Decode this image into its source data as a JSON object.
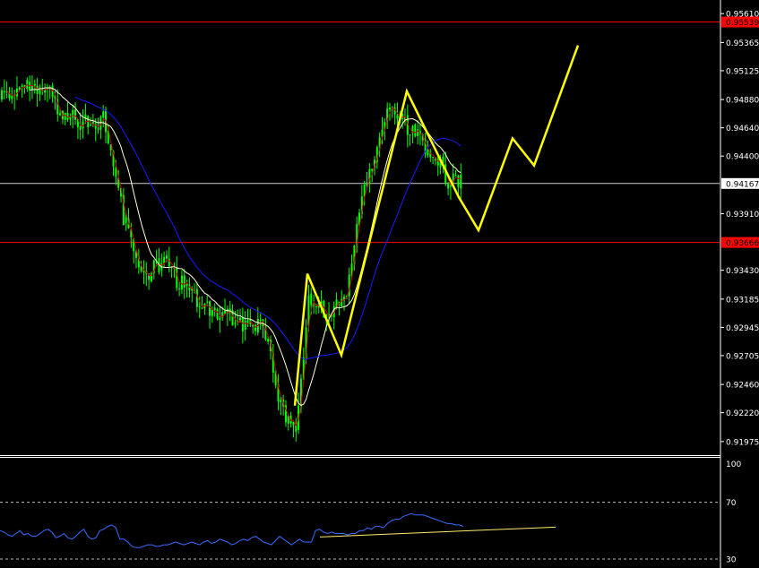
{
  "chart_data": [
    {
      "type": "candlestick",
      "title": "",
      "price_axis": {
        "range": [
          0.9189,
          0.9568
        ],
        "ticks": [
          "0.95610",
          "0.95365",
          "0.95125",
          "0.94880",
          "0.94640",
          "0.94400",
          "0.93910",
          "0.93430",
          "0.93185",
          "0.92945",
          "0.92705",
          "0.92460",
          "0.92220",
          "0.91975"
        ]
      },
      "horizontal_levels": [
        {
          "label": "0.95539",
          "value": 0.95539,
          "color": "#ff0000"
        },
        {
          "label": "0.94167",
          "value": 0.94167,
          "color": "#cccccc"
        },
        {
          "label": "0.93666",
          "value": 0.93666,
          "color": "#ff0000"
        }
      ],
      "candle_color": "#00ff00",
      "anchors": [
        [
          0,
          0.949
        ],
        [
          10,
          0.9502
        ],
        [
          18,
          0.9494
        ],
        [
          25,
          0.9475
        ],
        [
          33,
          0.9468
        ],
        [
          40,
          0.947
        ],
        [
          48,
          0.9388
        ],
        [
          55,
          0.9336
        ],
        [
          63,
          0.935
        ],
        [
          73,
          0.9326
        ],
        [
          83,
          0.931
        ],
        [
          95,
          0.9297
        ],
        [
          103,
          0.9298
        ],
        [
          110,
          0.9225
        ],
        [
          116,
          0.9212
        ],
        [
          121,
          0.9318
        ],
        [
          128,
          0.9308
        ],
        [
          136,
          0.932
        ],
        [
          141,
          0.9395
        ],
        [
          151,
          0.9472
        ],
        [
          156,
          0.9475
        ],
        [
          163,
          0.9458
        ],
        [
          171,
          0.9438
        ],
        [
          176,
          0.942
        ],
        [
          181,
          0.9418
        ]
      ],
      "candle_count": 182,
      "moving_averages": [
        {
          "color": "#cc0000",
          "period": 3
        },
        {
          "color": "#ffffe0",
          "period": 12
        },
        {
          "color": "#1a1aff",
          "period": 30
        }
      ],
      "projection": {
        "color": "#ffff00",
        "points": [
          [
            329,
            0.9228
          ],
          [
            343,
            0.934
          ],
          [
            381,
            0.9271
          ],
          [
            454,
            0.9495
          ],
          [
            512,
            0.9405
          ],
          [
            534,
            0.9377
          ],
          [
            572,
            0.9455
          ],
          [
            596,
            0.9432
          ],
          [
            645,
            0.9534
          ]
        ]
      }
    },
    {
      "type": "line",
      "title": "",
      "range": [
        30,
        100
      ],
      "levels": [
        {
          "label": "70",
          "value": 70
        },
        {
          "label": "30",
          "value": 30
        }
      ],
      "tick_labels": [
        "100",
        "70",
        "30"
      ],
      "series_color": "#3c6cff",
      "trendline": {
        "color": "#ffee66",
        "from": [
          357,
          45.5
        ],
        "to": [
          620,
          52.5
        ]
      },
      "values": [
        50,
        49,
        47,
        46,
        48,
        50,
        47,
        48,
        46,
        46,
        48,
        50,
        51,
        49,
        45,
        46,
        48,
        45,
        44,
        46,
        49,
        51,
        46,
        44,
        45,
        50,
        51,
        53,
        54,
        52,
        44,
        44,
        42,
        39,
        38,
        38,
        39,
        40,
        40,
        39,
        39,
        40,
        40,
        41,
        42,
        41,
        40,
        41,
        42,
        41,
        40,
        42,
        43,
        41,
        42,
        44,
        43,
        42,
        40,
        41,
        43,
        44,
        43,
        45,
        46,
        44,
        42,
        41,
        40,
        43,
        46,
        44,
        42,
        40,
        42,
        44,
        42,
        42,
        42,
        50,
        51,
        49,
        48,
        49,
        48,
        48,
        48,
        47,
        48,
        48,
        50,
        50,
        52,
        51,
        53,
        53,
        52,
        55,
        57,
        58,
        58,
        60,
        61,
        62,
        61,
        61,
        61,
        60,
        59,
        58,
        57,
        56,
        55,
        55,
        54,
        54,
        53
      ]
    }
  ]
}
